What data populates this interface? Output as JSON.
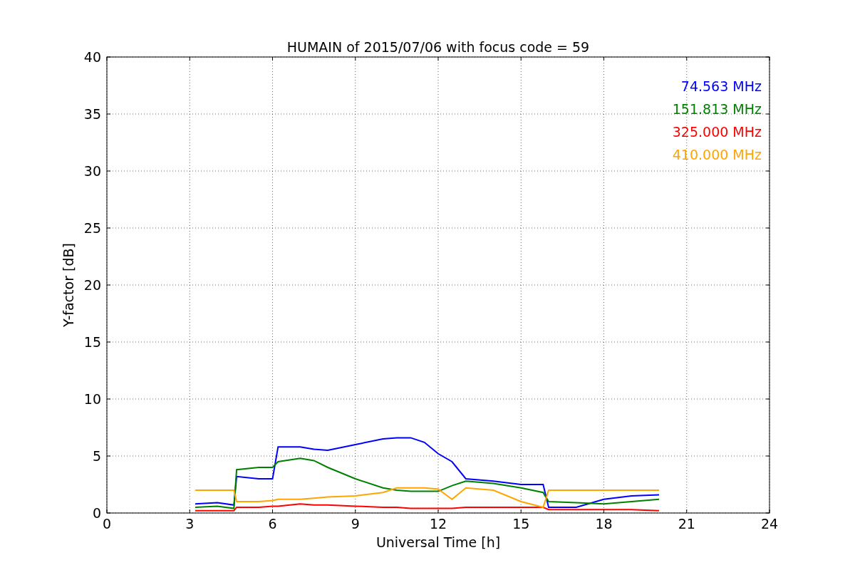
{
  "chart_data": {
    "type": "line",
    "title": "HUMAIN of 2015/07/06 with focus code = 59",
    "xlabel": "Universal Time [h]",
    "ylabel": "Y-factor [dB]",
    "x": [
      3.2,
      4.0,
      4.6,
      4.7,
      5.5,
      6.0,
      6.2,
      7.0,
      7.5,
      8.0,
      9.0,
      10.0,
      10.5,
      11.0,
      11.5,
      12.0,
      12.5,
      13.0,
      14.0,
      15.0,
      15.8,
      16.0,
      17.0,
      18.0,
      19.0,
      20.0
    ],
    "series": [
      {
        "name": "74.563 MHz",
        "color": "#0000ff",
        "values": [
          0.8,
          0.9,
          0.7,
          3.2,
          3.0,
          3.0,
          5.8,
          5.8,
          5.6,
          5.5,
          6.0,
          6.5,
          6.6,
          6.6,
          6.2,
          5.2,
          4.5,
          3.0,
          2.8,
          2.5,
          2.5,
          0.5,
          0.5,
          1.2,
          1.5,
          1.6
        ]
      },
      {
        "name": "151.813 MHz",
        "color": "#008000",
        "values": [
          0.5,
          0.6,
          0.4,
          3.8,
          4.0,
          4.0,
          4.5,
          4.8,
          4.6,
          4.0,
          3.0,
          2.2,
          2.0,
          1.9,
          1.9,
          1.9,
          2.4,
          2.8,
          2.6,
          2.2,
          1.8,
          1.0,
          0.9,
          0.8,
          1.0,
          1.2
        ]
      },
      {
        "name": "325.000 MHz",
        "color": "#ff0000",
        "values": [
          0.2,
          0.2,
          0.2,
          0.5,
          0.5,
          0.6,
          0.6,
          0.8,
          0.7,
          0.7,
          0.6,
          0.5,
          0.5,
          0.4,
          0.4,
          0.4,
          0.4,
          0.5,
          0.5,
          0.5,
          0.5,
          0.3,
          0.3,
          0.3,
          0.3,
          0.2
        ]
      },
      {
        "name": "410.000 MHz",
        "color": "#ffa500",
        "values": [
          2.0,
          2.0,
          2.0,
          1.0,
          1.0,
          1.1,
          1.2,
          1.2,
          1.3,
          1.4,
          1.5,
          1.8,
          2.2,
          2.2,
          2.2,
          2.1,
          1.2,
          2.2,
          2.0,
          1.0,
          0.5,
          2.0,
          2.0,
          2.0,
          2.0,
          2.0
        ]
      }
    ],
    "xlim": [
      0,
      24
    ],
    "ylim": [
      0,
      40
    ],
    "xticks": [
      0,
      3,
      6,
      9,
      12,
      15,
      18,
      21,
      24
    ],
    "yticks": [
      0,
      5,
      10,
      15,
      20,
      25,
      30,
      35,
      40
    ],
    "grid": true
  }
}
